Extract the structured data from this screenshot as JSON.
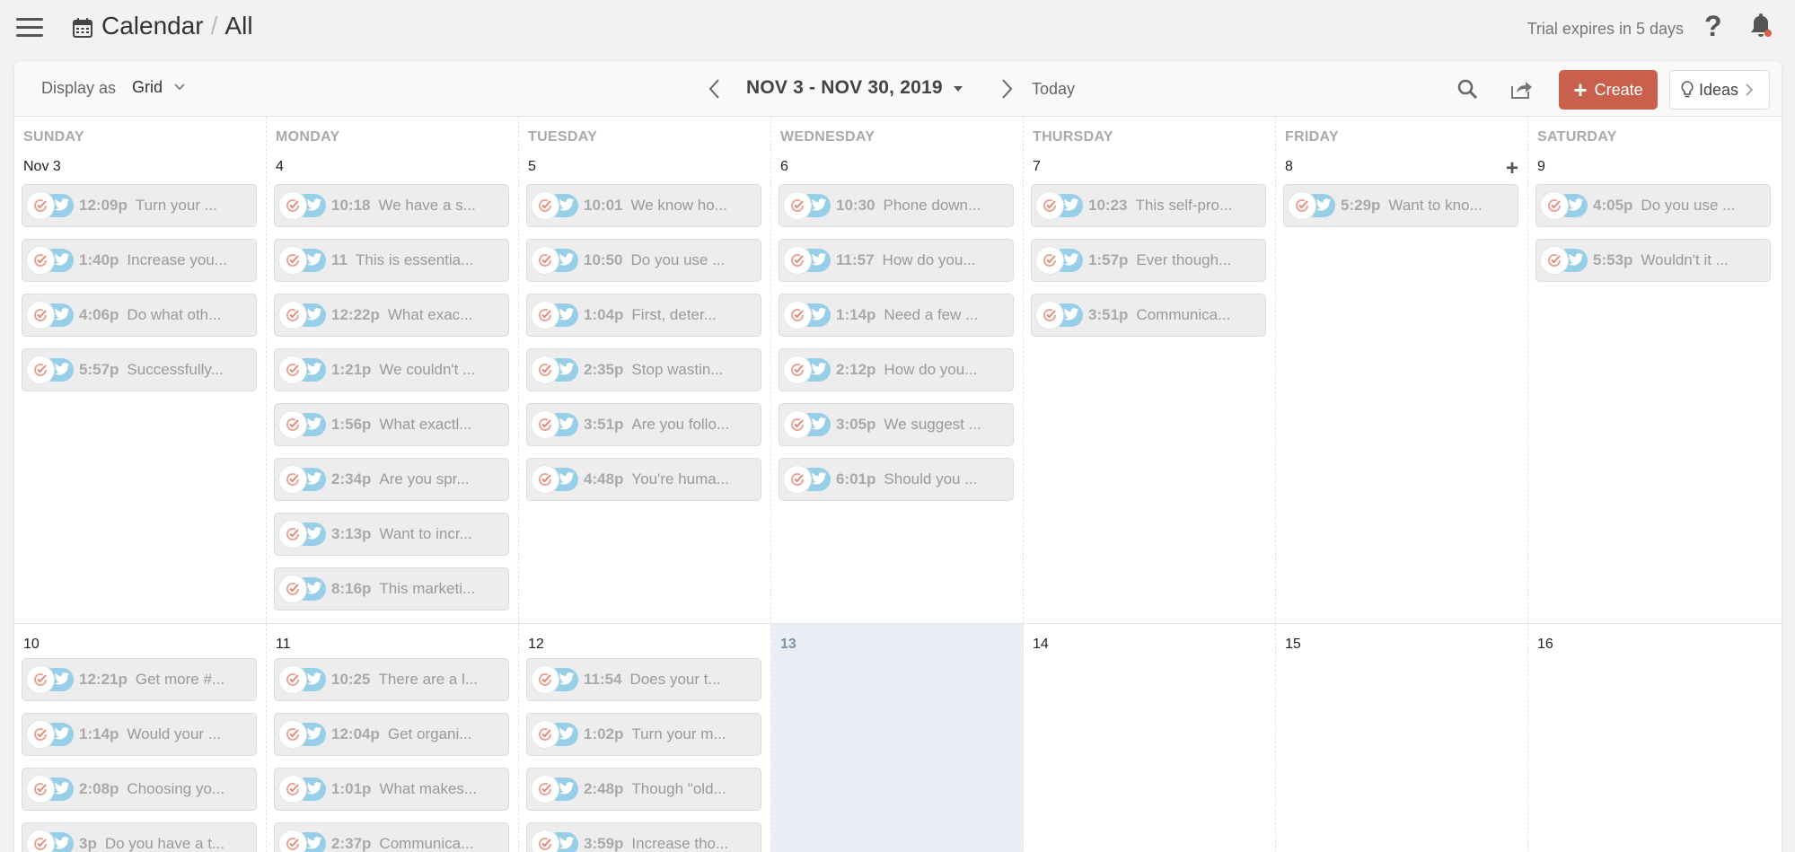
{
  "header": {
    "title": "Calendar",
    "separator": "/",
    "subtitle": "All",
    "trial_text": "Trial expires in 5 days",
    "help_label": "?"
  },
  "toolbar": {
    "display_as_label": "Display as",
    "display_value": "Grid",
    "date_range": "NOV 3 - NOV 30, 2019",
    "today_label": "Today",
    "create_label": "Create",
    "ideas_label": "Ideas"
  },
  "colors": {
    "accent": "#c8604c",
    "twitter": "#97cfe8",
    "today_bg": "#e9eff4"
  },
  "days_of_week": [
    "SUNDAY",
    "MONDAY",
    "TUESDAY",
    "WEDNESDAY",
    "THURSDAY",
    "FRIDAY",
    "SATURDAY"
  ],
  "weeks": [
    {
      "days": [
        {
          "date": "Nov 3",
          "posts": [
            {
              "time": "12:09p",
              "text": "Turn your ..."
            },
            {
              "time": "1:40p",
              "text": "Increase you..."
            },
            {
              "time": "4:06p",
              "text": "Do what oth..."
            },
            {
              "time": "5:57p",
              "text": "Successfully..."
            }
          ]
        },
        {
          "date": "4",
          "posts": [
            {
              "time": "10:18",
              "text": "We have a s..."
            },
            {
              "time": "11",
              "text": "This is essentia..."
            },
            {
              "time": "12:22p",
              "text": "What exac..."
            },
            {
              "time": "1:21p",
              "text": "We couldn't ..."
            },
            {
              "time": "1:56p",
              "text": "What exactl..."
            },
            {
              "time": "2:34p",
              "text": "Are you spr..."
            },
            {
              "time": "3:13p",
              "text": "Want to incr..."
            },
            {
              "time": "8:16p",
              "text": "This marketi..."
            }
          ]
        },
        {
          "date": "5",
          "posts": [
            {
              "time": "10:01",
              "text": "We know ho..."
            },
            {
              "time": "10:50",
              "text": "Do you use ..."
            },
            {
              "time": "1:04p",
              "text": "First, deter..."
            },
            {
              "time": "2:35p",
              "text": "Stop wastin..."
            },
            {
              "time": "3:51p",
              "text": "Are you follo..."
            },
            {
              "time": "4:48p",
              "text": "You're huma..."
            }
          ]
        },
        {
          "date": "6",
          "posts": [
            {
              "time": "10:30",
              "text": "Phone down..."
            },
            {
              "time": "11:57",
              "text": "How do you..."
            },
            {
              "time": "1:14p",
              "text": "Need a few ..."
            },
            {
              "time": "2:12p",
              "text": "How do you..."
            },
            {
              "time": "3:05p",
              "text": "We suggest ..."
            },
            {
              "time": "6:01p",
              "text": "Should you ..."
            }
          ]
        },
        {
          "date": "7",
          "posts": [
            {
              "time": "10:23",
              "text": "This self-pro..."
            },
            {
              "time": "1:57p",
              "text": "Ever though..."
            },
            {
              "time": "3:51p",
              "text": "Communica..."
            }
          ]
        },
        {
          "date": "8",
          "add": "+",
          "posts": [
            {
              "time": "5:29p",
              "text": "Want to kno..."
            }
          ]
        },
        {
          "date": "9",
          "posts": [
            {
              "time": "4:05p",
              "text": "Do you use ..."
            },
            {
              "time": "5:53p",
              "text": "Wouldn't it ..."
            }
          ]
        }
      ]
    },
    {
      "days": [
        {
          "date": "10",
          "posts": [
            {
              "time": "12:21p",
              "text": "Get more #..."
            },
            {
              "time": "1:14p",
              "text": "Would your ..."
            },
            {
              "time": "2:08p",
              "text": "Choosing yo..."
            },
            {
              "time": "3p",
              "text": "Do you have a t..."
            }
          ]
        },
        {
          "date": "11",
          "posts": [
            {
              "time": "10:25",
              "text": "There are a l..."
            },
            {
              "time": "12:04p",
              "text": "Get organi..."
            },
            {
              "time": "1:01p",
              "text": "What makes..."
            },
            {
              "time": "2:37p",
              "text": "Communica..."
            }
          ]
        },
        {
          "date": "12",
          "posts": [
            {
              "time": "11:54",
              "text": "Does your t..."
            },
            {
              "time": "1:02p",
              "text": "Turn your m..."
            },
            {
              "time": "2:48p",
              "text": "Though \"old..."
            },
            {
              "time": "3:59p",
              "text": "Increase tho..."
            }
          ]
        },
        {
          "date": "13",
          "today": true,
          "posts": []
        },
        {
          "date": "14",
          "posts": []
        },
        {
          "date": "15",
          "posts": []
        },
        {
          "date": "16",
          "posts": []
        }
      ]
    }
  ]
}
